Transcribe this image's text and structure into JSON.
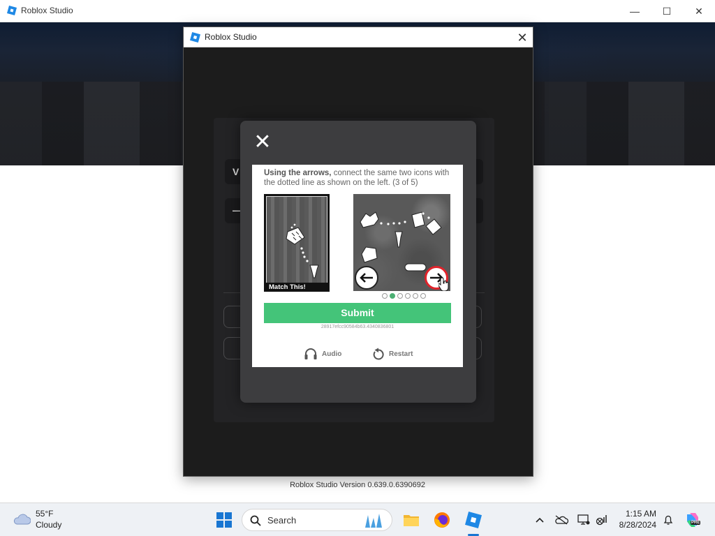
{
  "app": {
    "title": "Roblox Studio",
    "window_controls": {
      "minimize": "—",
      "maximize": "☐",
      "close": "✕"
    }
  },
  "dialog": {
    "title": "Roblox Studio",
    "close": "✕",
    "version": "Roblox Studio Version 0.639.0.6390692",
    "ghost_letters": [
      "V",
      "—"
    ]
  },
  "captcha": {
    "close": "✕",
    "instruction_bold": "Using the arrows,",
    "instruction_rest": " connect the same two icons with the dotted line as shown on the left. (3 of 5)",
    "match_label": "Match This!",
    "current_dot": 1,
    "total_dots": 6,
    "submit_label": "Submit",
    "session_id": "28917efcc90584b63.4340836801",
    "audio_label": "Audio",
    "restart_label": "Restart",
    "submit_color": "#44c479"
  },
  "taskbar": {
    "weather_temp": "55°F",
    "weather_condition": "Cloudy",
    "search_placeholder": "Search",
    "clock_time": "1:15 AM",
    "clock_date": "8/28/2024",
    "copilot_badge": "PRE"
  }
}
